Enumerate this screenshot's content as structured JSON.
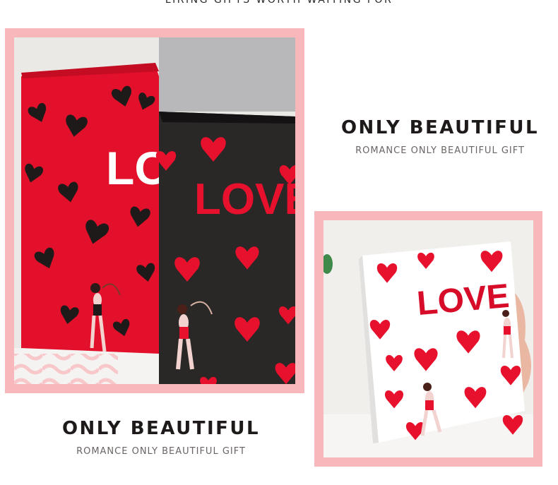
{
  "page": {
    "tagline": "LIRING GIFTS WORTH WAITING FOR"
  },
  "feature_right": {
    "title": "ONLY BEAUTIFUL",
    "subtitle": "ROMANCE ONLY BEAUTIFUL GIFT"
  },
  "feature_left": {
    "title": "ONLY BEAUTIFUL",
    "subtitle": "ROMANCE ONLY BEAUTIFUL GIFT"
  },
  "photo_left": {
    "red_box_text": "LOV",
    "black_box_text": "LOVE"
  },
  "photo_right": {
    "white_box_text": "LOVE"
  },
  "colors": {
    "frame_pink": "#f8b7ba",
    "box_red": "#e2102a",
    "box_black": "#2a2727",
    "heart_red": "#e8112d",
    "heading": "#1e1a19"
  }
}
